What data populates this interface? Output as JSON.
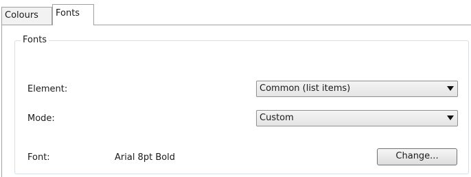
{
  "tabs": [
    {
      "label": "Colours",
      "active": false
    },
    {
      "label": "Fonts",
      "active": true
    }
  ],
  "group": {
    "title": "Fonts"
  },
  "fields": {
    "element": {
      "label": "Element:",
      "selected": "Common (list items)"
    },
    "mode": {
      "label": "Mode:",
      "selected": "Custom"
    },
    "font": {
      "label": "Font:",
      "value": "Arial 8pt Bold",
      "button_label": "Change..."
    }
  },
  "icons": {
    "combo_arrow": "chevron-down-icon"
  }
}
